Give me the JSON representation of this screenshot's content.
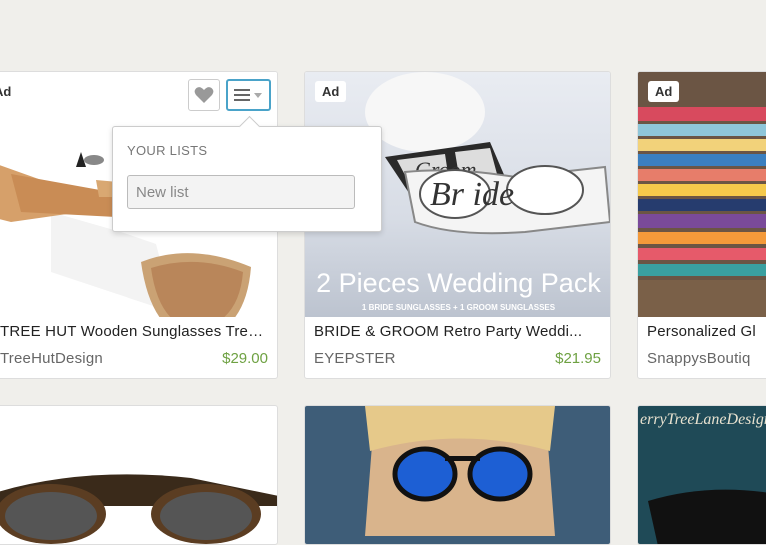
{
  "listings": [
    {
      "title": "TREE HUT Wooden Sunglasses Tree...",
      "shop": "TreeHutDesign",
      "price": "$29.00",
      "badge": "Ad"
    },
    {
      "title": "BRIDE & GROOM Retro Party Weddi...",
      "shop": "EYEPSTER",
      "price": "$21.95",
      "badge": "Ad",
      "image_text": {
        "bride": "Br ide",
        "groom": "Groom",
        "pack": "2 Pieces Wedding Pack",
        "pack_sub": "1 BRIDE SUNGLASSES + 1 GROOM SUNGLASSES"
      }
    },
    {
      "title": "Personalized Gl",
      "shop": "SnappysBoutiq",
      "badge": "Ad"
    },
    {
      "image_text": ""
    },
    {
      "image_text": ""
    },
    {
      "image_text": "erryTreeLaneDesigns"
    }
  ],
  "lists_popover": {
    "heading": "YOUR LISTS",
    "new_list_placeholder": "New list"
  },
  "icons": {
    "favorite": "heart-icon",
    "add_to_list": "list-menu-icon"
  },
  "colors": {
    "price": "#6ea142",
    "focus": "#4aa3c9"
  }
}
